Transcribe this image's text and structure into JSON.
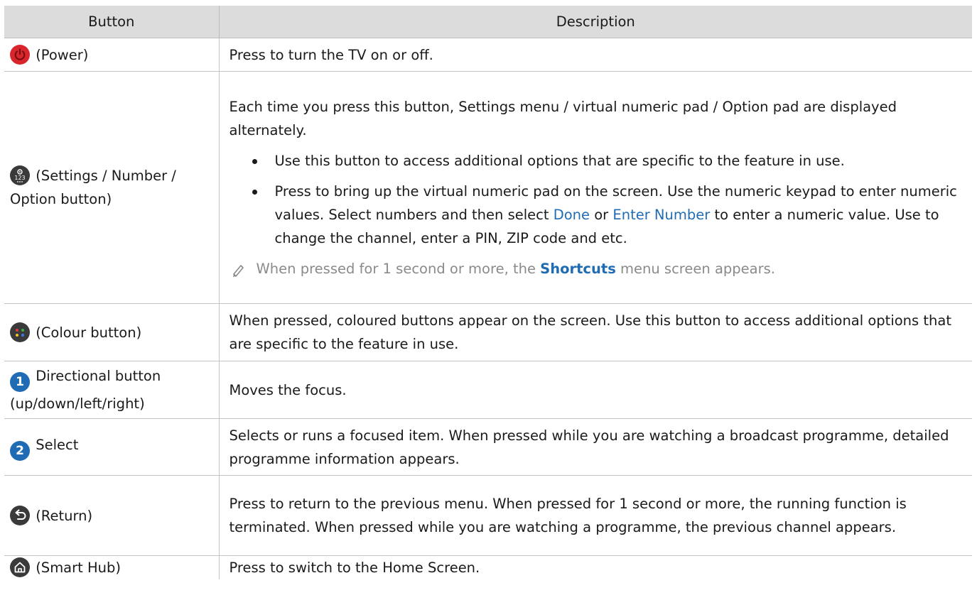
{
  "header": {
    "button": "Button",
    "description": "Description"
  },
  "rows": [
    {
      "button": "(Power)",
      "icon": "power-icon",
      "description": "Press to turn the TV on or off."
    },
    {
      "button": "(Settings / Number / Option button)",
      "icon": "settings-number-icon",
      "description": "Each time you press this button, Settings menu / virtual numeric pad / Option pad are displayed alternately.",
      "bullets": [
        "Use this button to access additional options that are specific to the feature in use.",
        {
          "pre": "Press to bring up the virtual numeric pad on the screen. Use the numeric keypad to enter numeric values. Select numbers and then select ",
          "link1": "Done",
          "mid": " or ",
          "link2": "Enter Number",
          "post": " to enter a numeric value. Use to change the channel, enter a PIN, ZIP code and etc."
        }
      ],
      "note": {
        "pre": "When pressed for 1 second or more, the ",
        "bold": "Shortcuts",
        "post": " menu screen appears."
      }
    },
    {
      "button": "(Colour button)",
      "icon": "colour-button-icon",
      "description": "When pressed, coloured buttons appear on the screen. Use this button to access additional options that are specific to the feature in use."
    },
    {
      "button": "Directional button (up/down/left/right)",
      "icon": "number-1-icon",
      "badge": "1",
      "description": "Moves the focus."
    },
    {
      "button": "Select",
      "icon": "number-2-icon",
      "badge": "2",
      "description": "Selects or runs a focused item. When pressed while you are watching a broadcast programme, detailed programme information appears."
    },
    {
      "button": "(Return)",
      "icon": "return-icon",
      "description": "Press to return to the previous menu. When pressed for 1 second or more, the running function is terminated. When pressed while you are watching a programme, the previous channel appears."
    },
    {
      "button": "(Smart Hub)",
      "icon": "home-icon",
      "description": "Press to switch to the Home Screen."
    }
  ],
  "colors": {
    "header_bg": "#dcdcdc",
    "link": "#1f6cb4",
    "power": "#d9262d",
    "icon_dark": "#3a3a3a",
    "note": "#8a8a8a"
  }
}
